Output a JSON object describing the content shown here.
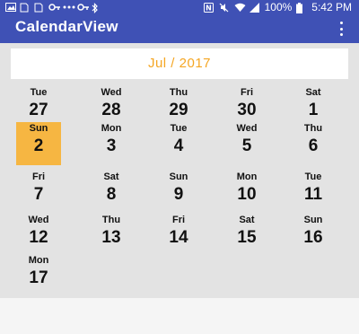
{
  "status_bar": {
    "battery": "100%",
    "time": "5:42 PM",
    "left_icons": [
      "image-icon",
      "sim-card-icon",
      "sim-card-icon",
      "key-icon",
      "dots-icon",
      "key-icon",
      "bluetooth-icon"
    ],
    "right_icons": [
      "nfc-icon",
      "mute-icon",
      "wifi-icon",
      "signal-icon",
      "battery-icon"
    ]
  },
  "toolbar": {
    "title": "CalendarView",
    "overflow_icon": "more-vert-icon"
  },
  "calendar": {
    "month_label": "Jul / 2017",
    "accent_color": "#f5a623",
    "selected_color": "#f6b642",
    "rows": [
      [
        {
          "dow": "Tue",
          "day": "27",
          "selected": false
        },
        {
          "dow": "Wed",
          "day": "28",
          "selected": false
        },
        {
          "dow": "Thu",
          "day": "29",
          "selected": false
        },
        {
          "dow": "Fri",
          "day": "30",
          "selected": false
        },
        {
          "dow": "Sat",
          "day": "1",
          "selected": false
        }
      ],
      [
        {
          "dow": "Sun",
          "day": "2",
          "selected": true
        },
        {
          "dow": "Mon",
          "day": "3",
          "selected": false
        },
        {
          "dow": "Tue",
          "day": "4",
          "selected": false
        },
        {
          "dow": "Wed",
          "day": "5",
          "selected": false
        },
        {
          "dow": "Thu",
          "day": "6",
          "selected": false
        }
      ],
      [
        {
          "dow": "Fri",
          "day": "7",
          "selected": false
        },
        {
          "dow": "Sat",
          "day": "8",
          "selected": false
        },
        {
          "dow": "Sun",
          "day": "9",
          "selected": false
        },
        {
          "dow": "Mon",
          "day": "10",
          "selected": false
        },
        {
          "dow": "Tue",
          "day": "11",
          "selected": false
        }
      ],
      [
        {
          "dow": "Wed",
          "day": "12",
          "selected": false
        },
        {
          "dow": "Thu",
          "day": "13",
          "selected": false
        },
        {
          "dow": "Fri",
          "day": "14",
          "selected": false
        },
        {
          "dow": "Sat",
          "day": "15",
          "selected": false
        },
        {
          "dow": "Sun",
          "day": "16",
          "selected": false
        }
      ],
      [
        {
          "dow": "Mon",
          "day": "17",
          "selected": false
        }
      ]
    ]
  }
}
